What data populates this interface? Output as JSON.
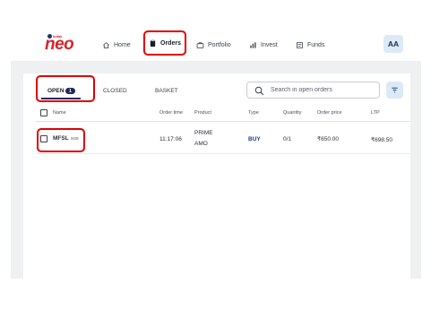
{
  "header": {
    "logo_small": "kotak",
    "logo_main": "neo",
    "nav": [
      {
        "label": "Home",
        "icon": "home-icon"
      },
      {
        "label": "Orders",
        "icon": "clipboard-icon"
      },
      {
        "label": "Portfolio",
        "icon": "briefcase-icon"
      },
      {
        "label": "Invest",
        "icon": "bar-chart-icon"
      },
      {
        "label": "Funds",
        "icon": "wallet-icon"
      }
    ],
    "avatar": "AA"
  },
  "tabs": {
    "open_label": "OPEN",
    "open_count": "1",
    "closed_label": "CLOSED",
    "basket_label": "BASKET"
  },
  "search": {
    "placeholder": "Search in open orders"
  },
  "table": {
    "columns": [
      "Name",
      "Order time",
      "Product",
      "Type",
      "Quantity",
      "Order price",
      "LTP"
    ],
    "rows": [
      {
        "name": "MFSL",
        "exchange": "NSE",
        "order_time": "11:17:06",
        "product_line1": "PRIME",
        "product_line2": "AMO",
        "type": "BUY",
        "quantity": "0/1",
        "order_price": "₹650.00",
        "ltp": "₹698.50"
      }
    ]
  },
  "colors": {
    "accent_red": "#e00000",
    "brand_red": "#d8232a",
    "navy": "#1f2a5a",
    "buy_blue": "#1f3c88"
  }
}
